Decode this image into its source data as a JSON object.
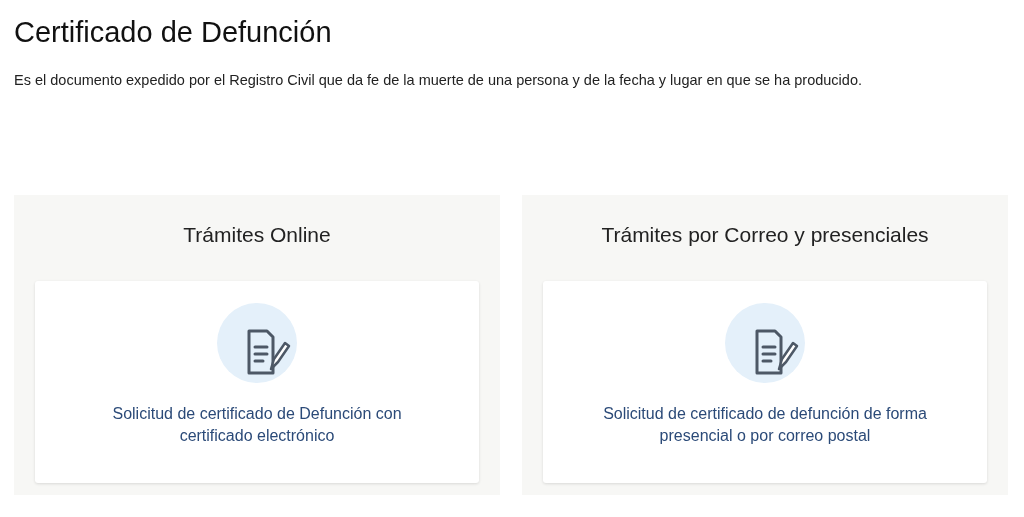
{
  "title": "Certificado de Defunción",
  "description": "Es el documento expedido por el Registro Civil que da fe de la muerte de una persona y de la fecha y lugar en que se ha producido.",
  "sections": [
    {
      "heading": "Trámites Online",
      "card": {
        "link": "Solicitud de certificado de Defunción con certificado electrónico"
      }
    },
    {
      "heading": "Trámites por Correo y presenciales",
      "card": {
        "link": "Solicitud de certificado de defunción de forma presencial o por correo postal"
      }
    }
  ]
}
